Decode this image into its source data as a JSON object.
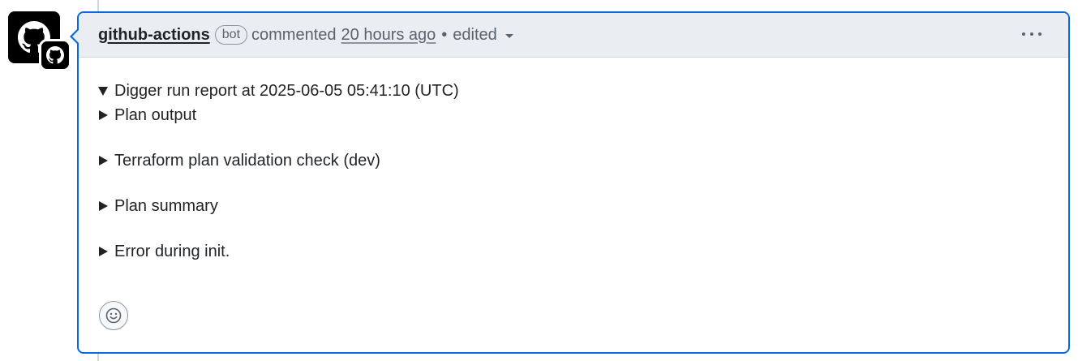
{
  "comment": {
    "author": "github-actions",
    "author_label": "bot",
    "action": "commented",
    "time": "20 hours ago",
    "separator": "•",
    "edited": "edited"
  },
  "body": {
    "report_title": "Digger run report at 2025-06-05 05:41:10 (UTC)",
    "sections": [
      "Plan output",
      "Terraform plan validation check (dev)",
      "Plan summary",
      "Error during init."
    ]
  },
  "icons": {
    "avatar": "github-mark-icon",
    "badge": "github-mark-icon",
    "menu": "kebab-horizontal-icon",
    "reaction": "smiley-icon"
  },
  "colors": {
    "accent": "#0969da",
    "header_bg": "#eaeef2",
    "text": "#1f2328",
    "muted": "#59636e"
  }
}
